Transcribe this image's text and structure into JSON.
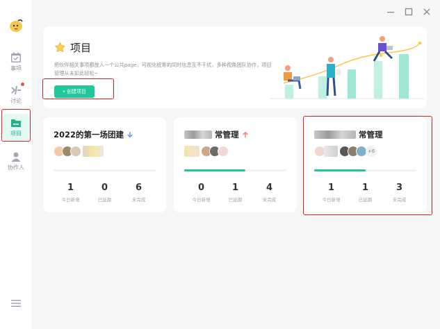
{
  "sidebar": {
    "items": [
      {
        "label": "事项",
        "icon": "calendar-check-icon"
      },
      {
        "label": "讨论",
        "icon": "discussion-icon",
        "badge": true
      },
      {
        "label": "项目",
        "icon": "folder-icon",
        "active": true
      },
      {
        "label": "协作人",
        "icon": "user-icon"
      }
    ],
    "menu_icon": "menu-icon"
  },
  "banner": {
    "title": "项目",
    "description": "把伙伴相关事项都放入一个公共page，可视化统筹的同时信息互不干扰，多种视角团队协作，项目管理从未如此轻松~",
    "create_button": "+ 创建项目"
  },
  "cards": [
    {
      "title": "2022的第一场团建",
      "title_prefix_blur": false,
      "trend": "down",
      "more_count": "",
      "progress": 0,
      "stats": [
        {
          "value": "1",
          "label": "今日新增"
        },
        {
          "value": "0",
          "label": "已延期"
        },
        {
          "value": "6",
          "label": "未完成"
        }
      ]
    },
    {
      "title": "常管理",
      "title_prefix_blur": true,
      "trend": "up",
      "more_count": "",
      "progress": 0.6,
      "stats": [
        {
          "value": "0",
          "label": "今日新增"
        },
        {
          "value": "1",
          "label": "已延期"
        },
        {
          "value": "4",
          "label": "未完成"
        }
      ]
    },
    {
      "title": "常管理",
      "title_prefix_blur": true,
      "trend": "",
      "more_count": "+6",
      "progress": 0.5,
      "stats": [
        {
          "value": "1",
          "label": "今日新增"
        },
        {
          "value": "1",
          "label": "已延期"
        },
        {
          "value": "3",
          "label": "未完成"
        }
      ]
    }
  ],
  "colors": {
    "accent": "#1fc79b",
    "highlight": "#e41f1f",
    "active_bg": "#e2f8f1"
  }
}
